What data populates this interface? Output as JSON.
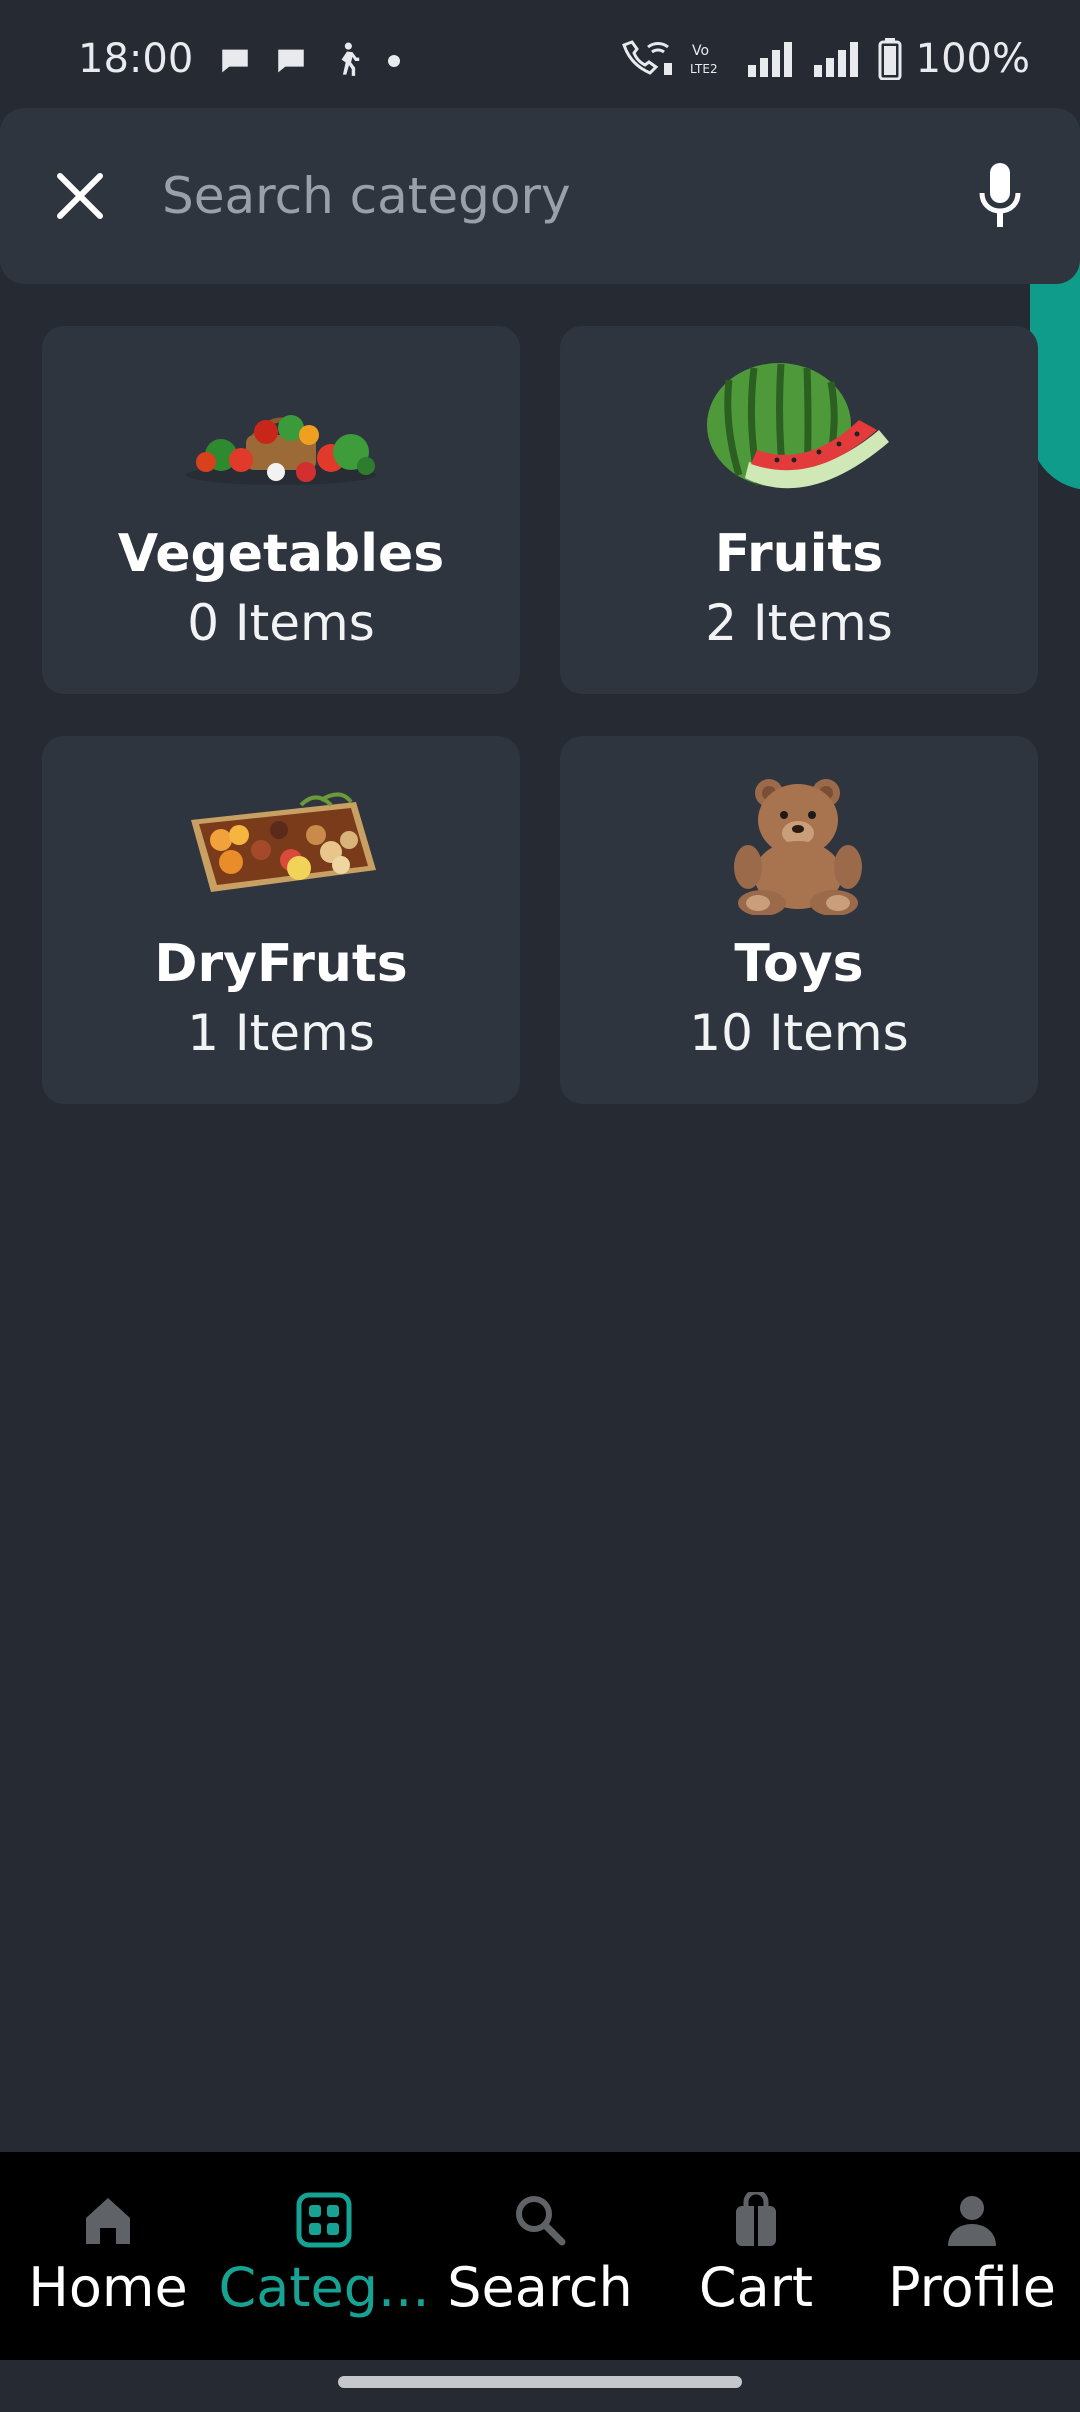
{
  "status_bar": {
    "time": "18:00",
    "battery": "100%",
    "network_label": "Vo LTE2"
  },
  "search": {
    "placeholder": "Search category",
    "value": ""
  },
  "categories": [
    {
      "title": "Vegetables",
      "count": "0 Items",
      "image_icon": "vegetables-basket"
    },
    {
      "title": "Fruits",
      "count": "2 Items",
      "image_icon": "watermelon"
    },
    {
      "title": "DryFruts",
      "count": "1 Items",
      "image_icon": "dry-fruit-tray"
    },
    {
      "title": "Toys",
      "count": "10 Items",
      "image_icon": "teddy-bear"
    }
  ],
  "bottom_nav": {
    "items": [
      {
        "label": "Home",
        "icon": "home-icon"
      },
      {
        "label": "Categ...",
        "icon": "grid-icon",
        "active": true
      },
      {
        "label": "Search",
        "icon": "search-icon"
      },
      {
        "label": "Cart",
        "icon": "bag-icon"
      },
      {
        "label": "Profile",
        "icon": "person-icon"
      }
    ]
  },
  "colors": {
    "background": "#252a33",
    "card": "#2f353f",
    "accent": "#16a394",
    "nav_background": "#000000"
  }
}
